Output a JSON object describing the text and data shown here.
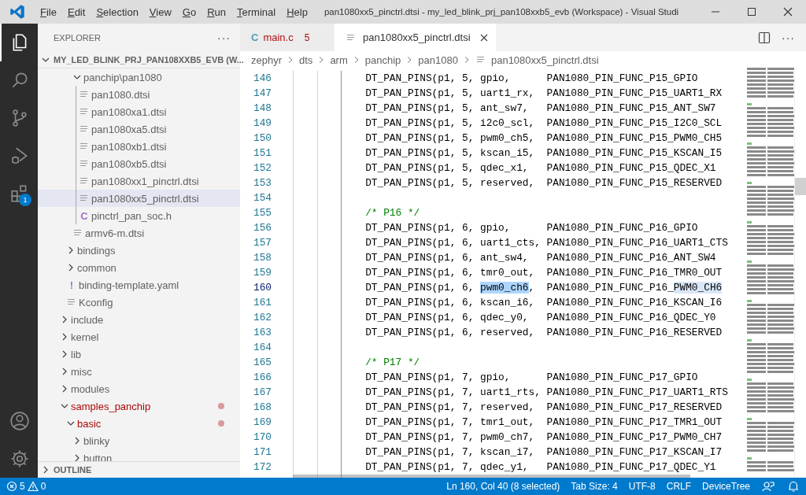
{
  "title_bar": {
    "menu": [
      "File",
      "Edit",
      "Selection",
      "View",
      "Go",
      "Run",
      "Terminal",
      "Help"
    ],
    "title": "pan1080xx5_pinctrl.dtsi - my_led_blink_prj_pan108xxb5_evb (Workspace) - Visual Studi"
  },
  "activity_bar": {
    "top": [
      {
        "kind": "explorer",
        "selected": true
      },
      {
        "kind": "search",
        "selected": false
      },
      {
        "kind": "source-control",
        "selected": false
      },
      {
        "kind": "run-debug",
        "selected": false
      },
      {
        "kind": "extensions",
        "selected": false,
        "badge": "1"
      }
    ],
    "bottom": [
      {
        "kind": "account"
      },
      {
        "kind": "settings"
      }
    ]
  },
  "sidebar": {
    "title": "EXPLORER",
    "more": "···",
    "root": {
      "label": "MY_LED_BLINK_PRJ_PAN108XXB5_EVB (W...",
      "expanded": true
    },
    "tree": [
      {
        "children": [
          {
            "children": [
              {
                "label": "panchip\\pan1080",
                "kind": "folder",
                "expanded": true,
                "selected": false,
                "modified": false,
                "children": [
                  {
                    "label": "pan1080.dtsi",
                    "kind": "file",
                    "selected": false,
                    "modified": false
                  },
                  {
                    "label": "pan1080xa1.dtsi",
                    "kind": "file",
                    "selected": false,
                    "modified": false
                  },
                  {
                    "label": "pan1080xa5.dtsi",
                    "kind": "file",
                    "selected": false,
                    "modified": false
                  },
                  {
                    "label": "pan1080xb1.dtsi",
                    "kind": "file",
                    "selected": false,
                    "modified": false
                  },
                  {
                    "label": "pan1080xb5.dtsi",
                    "kind": "file",
                    "selected": false,
                    "modified": false
                  },
                  {
                    "label": "pan1080xx1_pinctrl.dtsi",
                    "kind": "file",
                    "selected": false,
                    "modified": false
                  },
                  {
                    "label": "pan1080xx5_pinctrl.dtsi",
                    "kind": "file",
                    "selected": true,
                    "modified": false
                  },
                  {
                    "label": "pinctrl_pan_soc.h",
                    "kind": "c-file",
                    "icon_text": "C",
                    "selected": false,
                    "modified": false
                  }
                ]
              },
              {
                "label": "armv6-m.dtsi",
                "kind": "file",
                "selected": false,
                "modified": false
              }
            ]
          },
          {
            "label": "bindings",
            "kind": "folder",
            "expanded": false,
            "selected": false,
            "modified": false
          },
          {
            "label": "common",
            "kind": "folder",
            "expanded": false,
            "selected": false,
            "modified": false
          },
          {
            "label": "binding-template.yaml",
            "kind": "yaml",
            "icon_text": "!",
            "selected": false,
            "modified": false
          },
          {
            "label": "Kconfig",
            "kind": "file",
            "selected": false,
            "modified": false
          }
        ]
      },
      {
        "label": "include",
        "kind": "folder",
        "expanded": false,
        "selected": false,
        "modified": false
      },
      {
        "label": "kernel",
        "kind": "folder",
        "expanded": false,
        "selected": false,
        "modified": false
      },
      {
        "label": "lib",
        "kind": "folder",
        "expanded": false,
        "selected": false,
        "modified": false
      },
      {
        "label": "misc",
        "kind": "folder",
        "expanded": false,
        "selected": false,
        "modified": false
      },
      {
        "label": "modules",
        "kind": "folder",
        "expanded": false,
        "selected": false,
        "modified": false
      },
      {
        "label": "samples_panchip",
        "kind": "folder",
        "expanded": true,
        "selected": false,
        "modified": true,
        "children": [
          {
            "label": "basic",
            "kind": "folder",
            "expanded": true,
            "selected": false,
            "modified": true,
            "children": [
              {
                "label": "blinky",
                "kind": "folder",
                "expanded": false,
                "selected": false,
                "modified": false
              },
              {
                "label": "button",
                "kind": "folder",
                "expanded": false,
                "selected": false,
                "modified": false
              }
            ]
          }
        ]
      }
    ],
    "outline": {
      "label": "OUTLINE",
      "expanded": false
    }
  },
  "tabs": [
    {
      "label": "main.c",
      "kind": "c",
      "icon_text": "C",
      "problems": "5",
      "has_errors": true,
      "selected": false
    },
    {
      "label": "pan1080xx5_pinctrl.dtsi",
      "kind": "file",
      "has_errors": false,
      "selected": true
    }
  ],
  "editor_actions": {
    "more": "···"
  },
  "breadcrumbs": [
    "zephyr",
    "dts",
    "arm",
    "panchip",
    "pan1080",
    "pan1080xx5_pinctrl.dtsi"
  ],
  "code": {
    "lines": [
      {
        "number": "146",
        "kind": "code",
        "current": false,
        "text": "DT_PAN_PINS(p1, 5, gpio,      PAN1080_PIN_FUNC_P15_GPIO"
      },
      {
        "number": "147",
        "kind": "code",
        "current": false,
        "text": "DT_PAN_PINS(p1, 5, uart1_rx,  PAN1080_PIN_FUNC_P15_UART1_RX"
      },
      {
        "number": "148",
        "kind": "code",
        "current": false,
        "text": "DT_PAN_PINS(p1, 5, ant_sw7,   PAN1080_PIN_FUNC_P15_ANT_SW7"
      },
      {
        "number": "149",
        "kind": "code",
        "current": false,
        "text": "DT_PAN_PINS(p1, 5, i2c0_scl,  PAN1080_PIN_FUNC_P15_I2C0_SCL"
      },
      {
        "number": "150",
        "kind": "code",
        "current": false,
        "text": "DT_PAN_PINS(p1, 5, pwm0_ch5,  PAN1080_PIN_FUNC_P15_PWM0_CH5"
      },
      {
        "number": "151",
        "kind": "code",
        "current": false,
        "text": "DT_PAN_PINS(p1, 5, kscan_i5,  PAN1080_PIN_FUNC_P15_KSCAN_I5"
      },
      {
        "number": "152",
        "kind": "code",
        "current": false,
        "text": "DT_PAN_PINS(p1, 5, qdec_x1,   PAN1080_PIN_FUNC_P15_QDEC_X1"
      },
      {
        "number": "153",
        "kind": "code",
        "current": false,
        "text": "DT_PAN_PINS(p1, 5, reserved,  PAN1080_PIN_FUNC_P15_RESERVED"
      },
      {
        "number": "154",
        "kind": "blank",
        "current": false
      },
      {
        "number": "155",
        "kind": "comment",
        "current": false,
        "text": "/* P16 */"
      },
      {
        "number": "156",
        "kind": "code",
        "current": false,
        "text": "DT_PAN_PINS(p1, 6, gpio,      PAN1080_PIN_FUNC_P16_GPIO"
      },
      {
        "number": "157",
        "kind": "code",
        "current": false,
        "text": "DT_PAN_PINS(p1, 6, uart1_cts, PAN1080_PIN_FUNC_P16_UART1_CTS"
      },
      {
        "number": "158",
        "kind": "code",
        "current": false,
        "text": "DT_PAN_PINS(p1, 6, ant_sw4,   PAN1080_PIN_FUNC_P16_ANT_SW4"
      },
      {
        "number": "159",
        "kind": "code",
        "current": false,
        "text": "DT_PAN_PINS(p1, 6, tmr0_out,  PAN1080_PIN_FUNC_P16_TMR0_OUT"
      },
      {
        "number": "160",
        "kind": "code",
        "current": true,
        "segments": [
          {
            "text": "DT_PAN_PINS(p1, 6, ",
            "selected": false,
            "match": false
          },
          {
            "text": "pwm0_ch6",
            "selected": true,
            "match": false
          },
          {
            "text": ",  PAN1080_PIN_FUNC_P16_",
            "selected": false,
            "match": false
          },
          {
            "text": "PWM0_CH6",
            "selected": false,
            "match": true
          }
        ]
      },
      {
        "number": "161",
        "kind": "code",
        "current": false,
        "text": "DT_PAN_PINS(p1, 6, kscan_i6,  PAN1080_PIN_FUNC_P16_KSCAN_I6"
      },
      {
        "number": "162",
        "kind": "code",
        "current": false,
        "text": "DT_PAN_PINS(p1, 6, qdec_y0,   PAN1080_PIN_FUNC_P16_QDEC_Y0"
      },
      {
        "number": "163",
        "kind": "code",
        "current": false,
        "text": "DT_PAN_PINS(p1, 6, reserved,  PAN1080_PIN_FUNC_P16_RESERVED"
      },
      {
        "number": "164",
        "kind": "blank",
        "current": false
      },
      {
        "number": "165",
        "kind": "comment",
        "current": false,
        "text": "/* P17 */"
      },
      {
        "number": "166",
        "kind": "code",
        "current": false,
        "text": "DT_PAN_PINS(p1, 7, gpio,      PAN1080_PIN_FUNC_P17_GPIO"
      },
      {
        "number": "167",
        "kind": "code",
        "current": false,
        "text": "DT_PAN_PINS(p1, 7, uart1_rts, PAN1080_PIN_FUNC_P17_UART1_RTS"
      },
      {
        "number": "168",
        "kind": "code",
        "current": false,
        "text": "DT_PAN_PINS(p1, 7, reserved,  PAN1080_PIN_FUNC_P17_RESERVED"
      },
      {
        "number": "169",
        "kind": "code",
        "current": false,
        "text": "DT_PAN_PINS(p1, 7, tmr1_out,  PAN1080_PIN_FUNC_P17_TMR1_OUT"
      },
      {
        "number": "170",
        "kind": "code",
        "current": false,
        "text": "DT_PAN_PINS(p1, 7, pwm0_ch7,  PAN1080_PIN_FUNC_P17_PWM0_CH7"
      },
      {
        "number": "171",
        "kind": "code",
        "current": false,
        "text": "DT_PAN_PINS(p1, 7, kscan_i7,  PAN1080_PIN_FUNC_P17_KSCAN_I7"
      },
      {
        "number": "172",
        "kind": "code",
        "current": false,
        "text": "DT_PAN_PINS(p1, 7, qdec_y1,   PAN1080_PIN_FUNC_P17_QDEC_Y1"
      }
    ]
  },
  "status_bar": {
    "errors": "5",
    "warnings": "0",
    "items": [
      "Ln 160, Col 40 (8 selected)",
      "Tab Size: 4",
      "UTF-8",
      "CRLF",
      "DeviceTree"
    ]
  }
}
